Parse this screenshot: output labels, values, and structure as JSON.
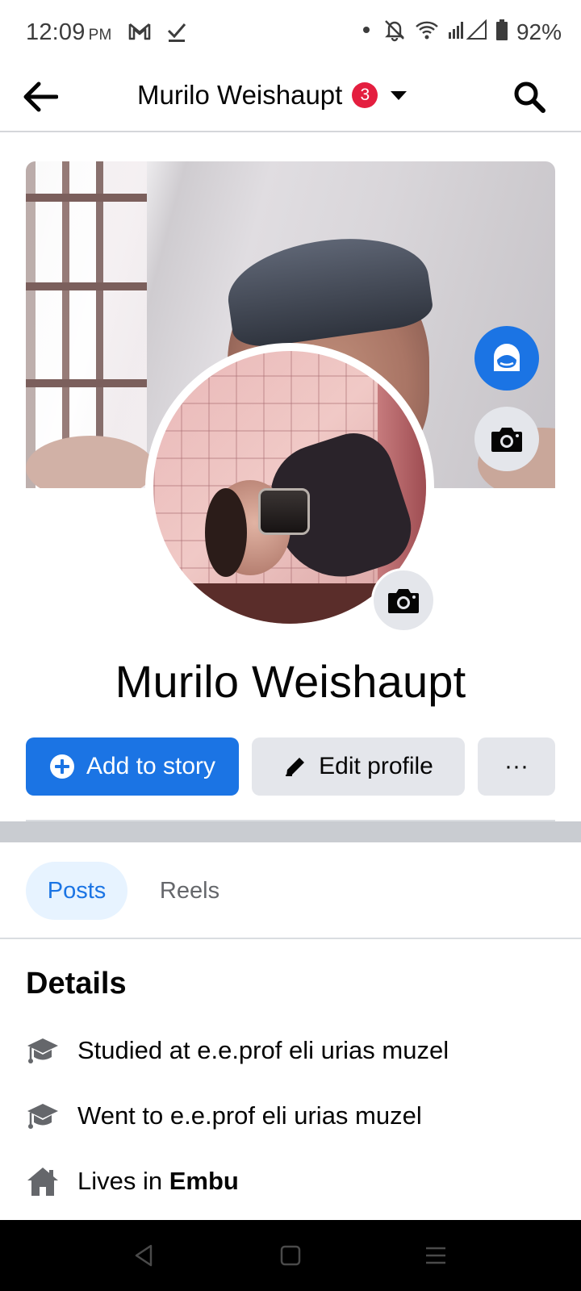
{
  "status_bar": {
    "time": "12:09",
    "ampm": "PM",
    "battery": "92%",
    "icons": [
      "gmail-icon",
      "download-done-icon",
      "dot-icon",
      "bell-off-icon",
      "wifi-icon",
      "signal-icon",
      "battery-icon"
    ]
  },
  "header": {
    "title": "Murilo Weishaupt",
    "notification_count": "3",
    "back_icon": "back-arrow-icon",
    "search_icon": "search-icon"
  },
  "profile": {
    "name": "Murilo Weishaupt"
  },
  "actions": {
    "add_story_label": "Add to story",
    "edit_profile_label": "Edit profile",
    "more_label": "···"
  },
  "tabs": [
    {
      "label": "Posts",
      "selected": true
    },
    {
      "label": "Reels",
      "selected": false
    }
  ],
  "details": {
    "title": "Details",
    "items": [
      {
        "prefix": "Studied at e.e.prof eli urias muzel",
        "bold": "",
        "icon": "graduation-cap-icon"
      },
      {
        "prefix": "Went to e.e.prof eli urias muzel",
        "bold": "",
        "icon": "graduation-cap-icon"
      },
      {
        "prefix": "Lives in ",
        "bold": "Embu",
        "icon": "home-icon"
      }
    ]
  },
  "colors": {
    "accent": "#1b74e4",
    "badge": "#e41e3f",
    "button_gray": "#e4e6eb",
    "tab_selected_bg": "#e7f3ff"
  }
}
